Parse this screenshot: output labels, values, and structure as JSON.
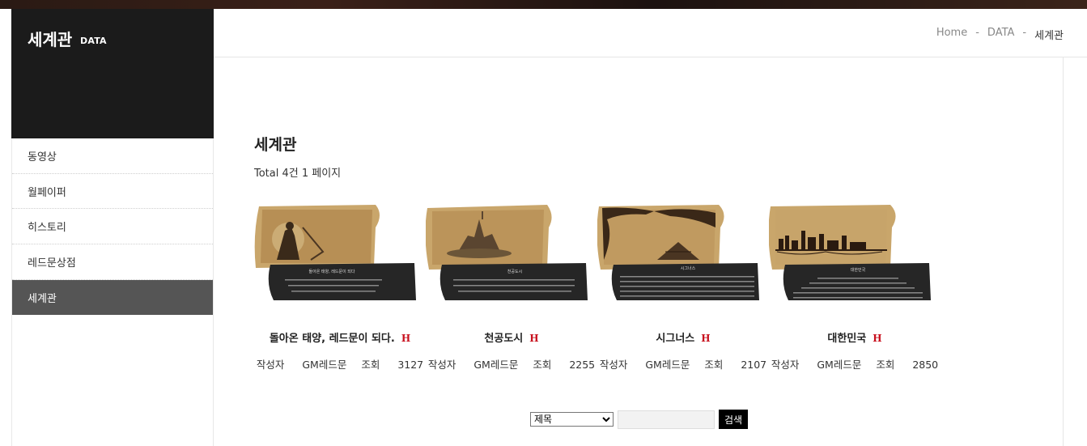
{
  "brand": {
    "title": "세계관",
    "subtitle": "DATA"
  },
  "breadcrumb": [
    "Home",
    "DATA",
    "세계관"
  ],
  "breadcrumb_separator": "-",
  "sidebar": {
    "items": [
      {
        "label": "동영상",
        "active": false
      },
      {
        "label": "월페이퍼",
        "active": false
      },
      {
        "label": "히스토리",
        "active": false
      },
      {
        "label": "레드문상점",
        "active": false
      },
      {
        "label": "세계관",
        "active": true
      }
    ]
  },
  "page": {
    "title": "세계관",
    "total": "Total 4건 1 페이지"
  },
  "posts": [
    {
      "title": "돌아온 태양, 레드문이 되다.",
      "badge": "H",
      "author_label": "작성자",
      "author": "GM레드문",
      "views_label": "조회",
      "views": "3127",
      "thumb_icon": "scroll-warrior-image"
    },
    {
      "title": "천공도시",
      "badge": "H",
      "author_label": "작성자",
      "author": "GM레드문",
      "views_label": "조회",
      "views": "2255",
      "thumb_icon": "scroll-sky-city-image"
    },
    {
      "title": "시그너스",
      "badge": "H",
      "author_label": "작성자",
      "author": "GM레드문",
      "views_label": "조회",
      "views": "2107",
      "thumb_icon": "scroll-pyramid-image"
    },
    {
      "title": "대한민국",
      "badge": "H",
      "author_label": "작성자",
      "author": "GM레드문",
      "views_label": "조회",
      "views": "2850",
      "thumb_icon": "scroll-skyline-image"
    }
  ],
  "thumb_captions": [
    "돌아온 태양, 레드문이 되다",
    "천공도시",
    "시그너스",
    "대한민국"
  ],
  "search": {
    "field_selected": "제목",
    "query": "",
    "button_label": "검색"
  },
  "colors": {
    "sidebar_dark": "#1b1b1b",
    "active_item": "#555555",
    "hot_badge": "#c8101e",
    "parchment": "#c9a66b"
  }
}
